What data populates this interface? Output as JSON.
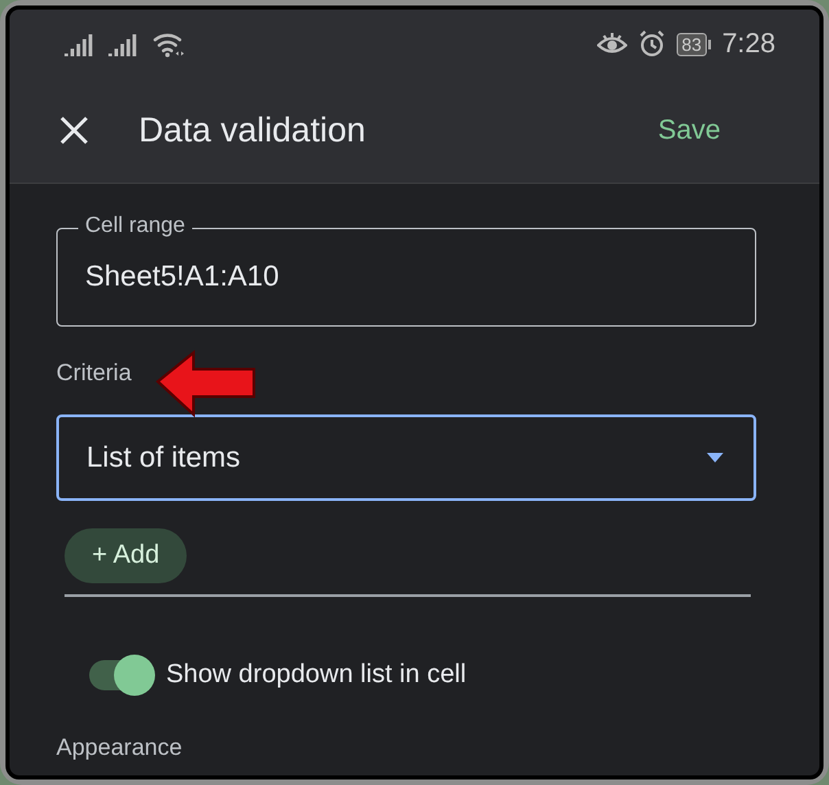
{
  "status_bar": {
    "battery": "83",
    "time": "7:28"
  },
  "app_bar": {
    "title": "Data validation",
    "action": "Save"
  },
  "cell_range": {
    "label": "Cell range",
    "value": "Sheet5!A1:A10"
  },
  "criteria": {
    "label": "Criteria",
    "value": "List of items",
    "focused": true
  },
  "add_button": "+ Add",
  "show_dropdown": {
    "label": "Show dropdown list in cell",
    "on": true
  },
  "appearance_label": "Appearance"
}
